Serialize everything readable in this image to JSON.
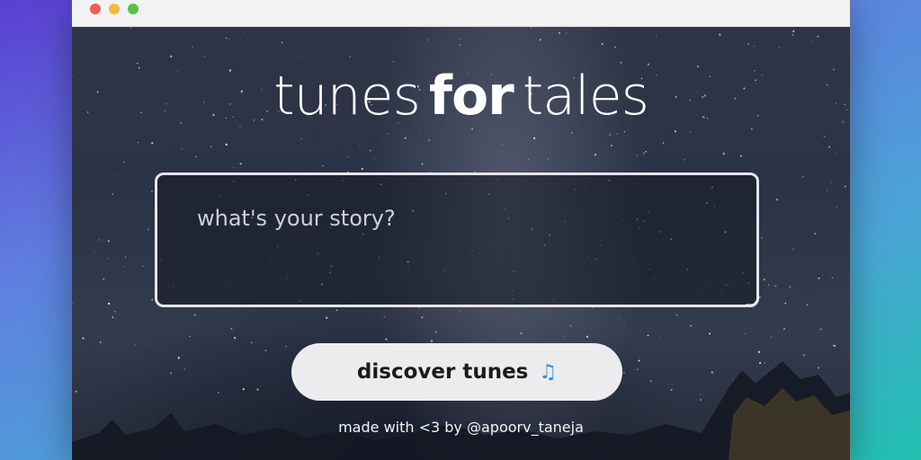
{
  "window": {
    "controls": [
      "close",
      "minimize",
      "zoom"
    ]
  },
  "logo": {
    "part1": "tunes",
    "part2": "for",
    "part3": "tales"
  },
  "story": {
    "placeholder": "what's your story?",
    "value": ""
  },
  "discover_button": {
    "label": "discover tunes",
    "icon": "music-notes-icon",
    "icon_glyph": "♫"
  },
  "footer": {
    "prefix": "made with <3 by ",
    "handle": "@apoorv_taneja"
  },
  "colors": {
    "button_bg": "#ececee",
    "text": "#ffffff",
    "input_border": "#e6e6ea"
  }
}
